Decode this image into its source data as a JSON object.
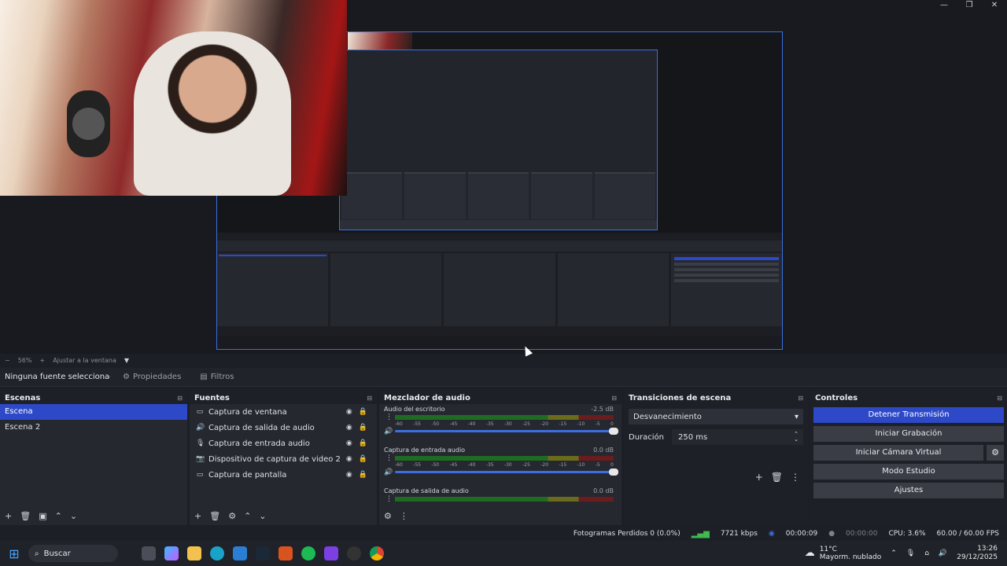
{
  "window": {
    "minimize": "—",
    "maximize": "❐",
    "close": "✕"
  },
  "zoom": {
    "level": "56%",
    "minus": "−",
    "plus": "+",
    "fit_label": "Ajustar a la ventana",
    "dropdown": "▼"
  },
  "properties_bar": {
    "no_source": "Ninguna fuente seleccionada",
    "properties_tab": "Propiedades",
    "filters_tab": "Filtros"
  },
  "scenes": {
    "title": "Escenas",
    "items": [
      "Escena",
      "Escena 2"
    ],
    "selected": 0
  },
  "sources": {
    "title": "Fuentes",
    "items": [
      {
        "label": "Captura de ventana",
        "icon": "window-icon"
      },
      {
        "label": "Captura de salida de audio",
        "icon": "speaker-icon"
      },
      {
        "label": "Captura de entrada audio",
        "icon": "mic-icon"
      },
      {
        "label": "Dispositivo de captura de video 2",
        "icon": "camera-icon"
      },
      {
        "label": "Captura de pantalla",
        "icon": "monitor-icon"
      }
    ]
  },
  "mixer": {
    "title": "Mezclador de audio",
    "ticks": [
      "-60",
      "-55",
      "-50",
      "-45",
      "-40",
      "-35",
      "-30",
      "-25",
      "-20",
      "-15",
      "-10",
      "-5",
      "0"
    ],
    "channels": [
      {
        "name": "Audio del escritorio",
        "db": "-2.5 dB",
        "volume": 1.0
      },
      {
        "name": "Captura de entrada audio",
        "db": "0.0 dB",
        "volume": 1.0
      },
      {
        "name": "Captura de salida de audio",
        "db": "0.0 dB",
        "volume": 1.0
      }
    ]
  },
  "transitions": {
    "title": "Transiciones de escena",
    "selected": "Desvanecimiento",
    "duration_label": "Duración",
    "duration_value": "250 ms"
  },
  "controls": {
    "title": "Controles",
    "stop_stream": "Detener Transmisión",
    "start_recording": "Iniciar Grabación",
    "start_virtual_cam": "Iniciar Cámara Virtual",
    "studio_mode": "Modo Estudio",
    "settings": "Ajustes"
  },
  "status": {
    "dropped_frames": "Fotogramas Perdidos 0 (0.0%)",
    "bitrate": "7721 kbps",
    "stream_time": "00:00:09",
    "rec_time": "00:00:00",
    "cpu": "CPU: 3.6%",
    "fps": "60.00 / 60.00 FPS"
  },
  "taskbar": {
    "search_placeholder": "Buscar",
    "weather_temp": "11°C",
    "weather_desc": "Mayorm. nublado",
    "time": "13:26",
    "date": "29/12/2025"
  },
  "colors": {
    "accent": "#2d49c8",
    "panel": "#262830",
    "background": "#1d1f26"
  }
}
